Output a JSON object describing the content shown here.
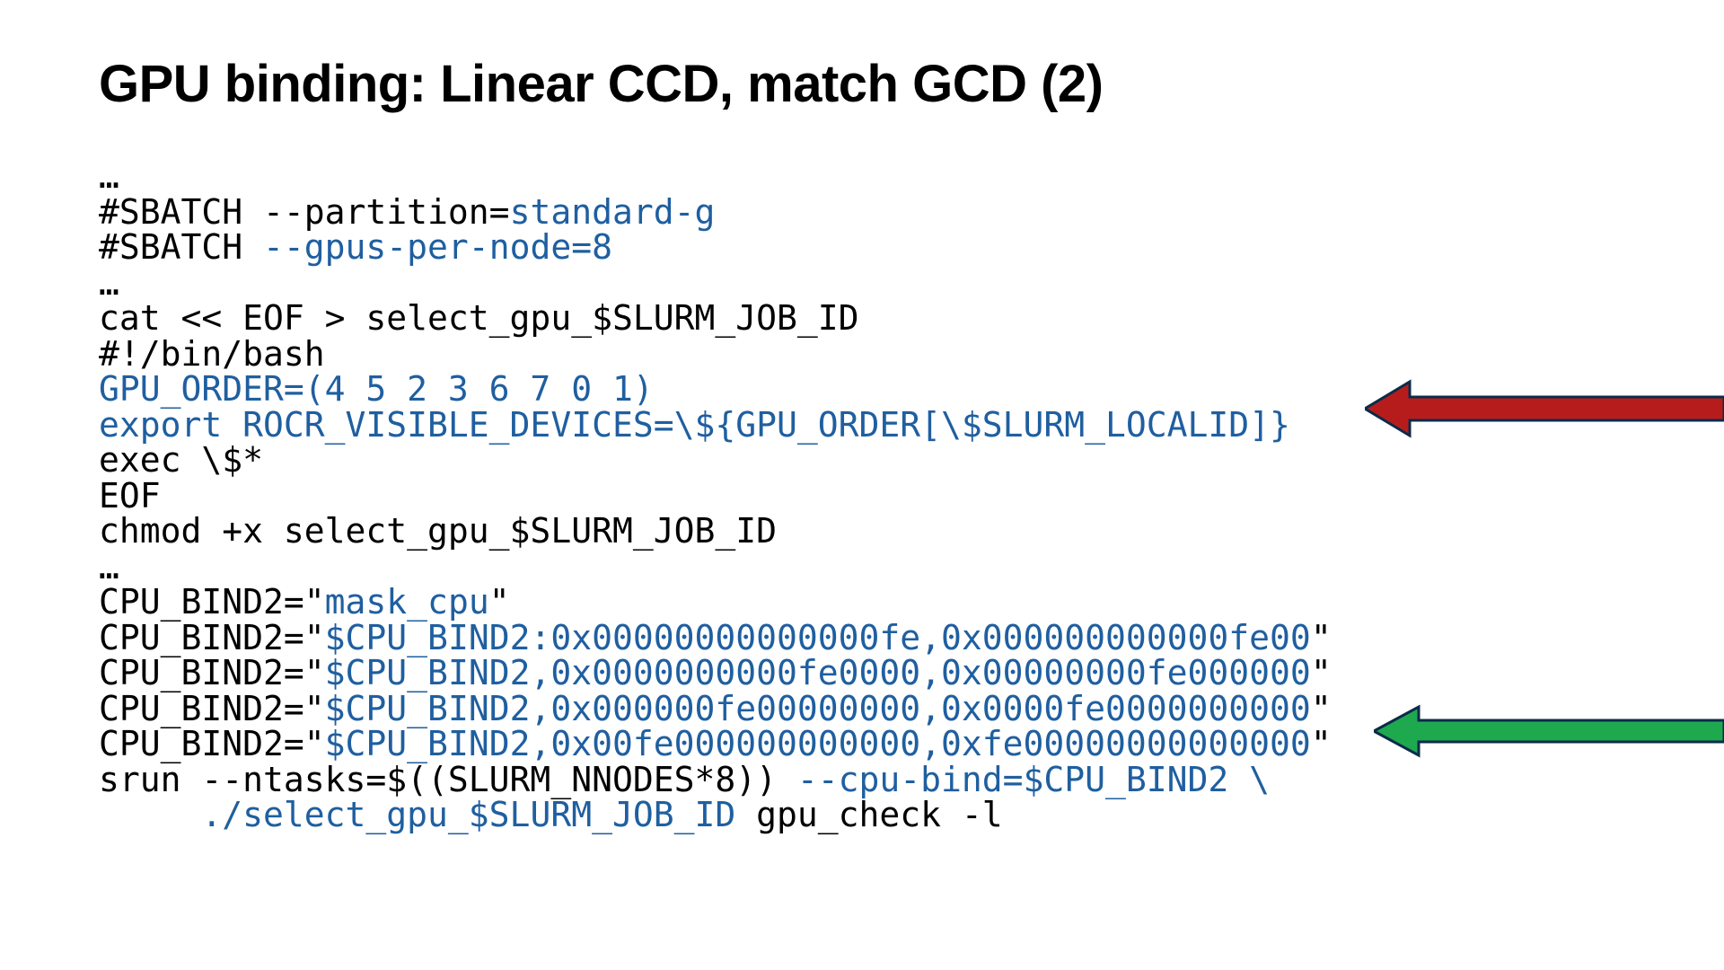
{
  "title": "GPU binding: Linear CCD, match GCD (2)",
  "code": {
    "ell1": "…",
    "sb1a": "#SBATCH --partition=",
    "sb1b": "standard-g",
    "sb2a": "#SBATCH ",
    "sb2b": "--gpus-per-node=8",
    "ell2": "…",
    "cat": "cat << EOF > select_gpu_$SLURM_JOB_ID",
    "shebang": "#!/bin/bash",
    "gpuorder": "GPU_ORDER=(4 5 2 3 6 7 0 1)",
    "export": "export ROCR_VISIBLE_DEVICES=\\${GPU_ORDER[\\$SLURM_LOCALID]}",
    "exec": "exec \\$*",
    "eof": "EOF",
    "chmod": "chmod +x select_gpu_$SLURM_JOB_ID",
    "ell3": "…",
    "cb0a": "CPU_BIND2=\"",
    "cb0b": "mask_cpu",
    "cb0c": "\"",
    "cb1a": "CPU_BIND2=\"",
    "cb1b": "$CPU_BIND2:0x00000000000000fe,0x000000000000fe00",
    "cb1c": "\"",
    "cb2a": "CPU_BIND2=\"",
    "cb2b": "$CPU_BIND2,0x0000000000fe0000,0x00000000fe000000",
    "cb2c": "\"",
    "cb3a": "CPU_BIND2=\"",
    "cb3b": "$CPU_BIND2,0x000000fe00000000,0x0000fe0000000000",
    "cb3c": "\"",
    "cb4a": "CPU_BIND2=\"",
    "cb4b": "$CPU_BIND2,0x00fe000000000000,0xfe00000000000000",
    "cb4c": "\"",
    "srun1a": "srun --ntasks=$((SLURM_NNODES*8)) ",
    "srun1b": "--cpu-bind=$CPU_BIND2 \\",
    "srun2a": "     ",
    "srun2b": "./select_gpu_$SLURM_JOB_ID",
    "srun2c": " gpu_check -l"
  },
  "arrows": {
    "red": "#b71c1c",
    "green": "#1ea94f",
    "stroke": "#0b2b4a"
  }
}
